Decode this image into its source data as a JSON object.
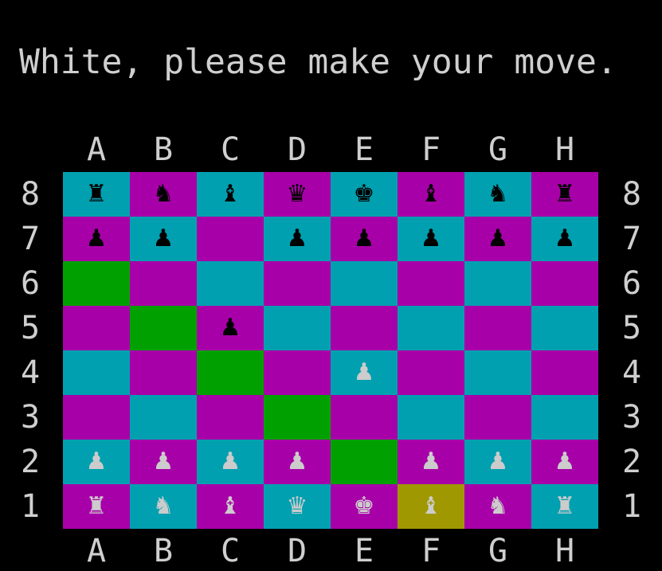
{
  "prompt": "White, please make your move.",
  "files": [
    "A",
    "B",
    "C",
    "D",
    "E",
    "F",
    "G",
    "H"
  ],
  "ranks": [
    "8",
    "7",
    "6",
    "5",
    "4",
    "3",
    "2",
    "1"
  ],
  "colors": {
    "background": "#000000",
    "text": "#cfcfcf",
    "square_cyan": "#00a0b0",
    "square_magenta": "#a800a8",
    "highlight_path": "#00a000",
    "highlight_selected": "#a09800",
    "piece_black": "#000000",
    "piece_white": "#cccccc"
  },
  "board": [
    [
      {
        "piece": "rook",
        "side": "black",
        "glyph": "♜"
      },
      {
        "piece": "knight",
        "side": "black",
        "glyph": "♞"
      },
      {
        "piece": "bishop",
        "side": "black",
        "glyph": "♝"
      },
      {
        "piece": "queen",
        "side": "black",
        "glyph": "♛"
      },
      {
        "piece": "king",
        "side": "black",
        "glyph": "♚"
      },
      {
        "piece": "bishop",
        "side": "black",
        "glyph": "♝"
      },
      {
        "piece": "knight",
        "side": "black",
        "glyph": "♞"
      },
      {
        "piece": "rook",
        "side": "black",
        "glyph": "♜"
      }
    ],
    [
      {
        "piece": "pawn",
        "side": "black",
        "glyph": "♟"
      },
      {
        "piece": "pawn",
        "side": "black",
        "glyph": "♟"
      },
      {
        "piece": "",
        "side": "",
        "glyph": ""
      },
      {
        "piece": "pawn",
        "side": "black",
        "glyph": "♟"
      },
      {
        "piece": "pawn",
        "side": "black",
        "glyph": "♟"
      },
      {
        "piece": "pawn",
        "side": "black",
        "glyph": "♟"
      },
      {
        "piece": "pawn",
        "side": "black",
        "glyph": "♟"
      },
      {
        "piece": "pawn",
        "side": "black",
        "glyph": "♟"
      }
    ],
    [
      {
        "piece": "",
        "side": "",
        "glyph": "",
        "highlight": "path"
      },
      {
        "piece": "",
        "side": "",
        "glyph": ""
      },
      {
        "piece": "",
        "side": "",
        "glyph": ""
      },
      {
        "piece": "",
        "side": "",
        "glyph": ""
      },
      {
        "piece": "",
        "side": "",
        "glyph": ""
      },
      {
        "piece": "",
        "side": "",
        "glyph": ""
      },
      {
        "piece": "",
        "side": "",
        "glyph": ""
      },
      {
        "piece": "",
        "side": "",
        "glyph": ""
      }
    ],
    [
      {
        "piece": "",
        "side": "",
        "glyph": ""
      },
      {
        "piece": "",
        "side": "",
        "glyph": "",
        "highlight": "path"
      },
      {
        "piece": "pawn",
        "side": "black",
        "glyph": "♟"
      },
      {
        "piece": "",
        "side": "",
        "glyph": ""
      },
      {
        "piece": "",
        "side": "",
        "glyph": ""
      },
      {
        "piece": "",
        "side": "",
        "glyph": ""
      },
      {
        "piece": "",
        "side": "",
        "glyph": ""
      },
      {
        "piece": "",
        "side": "",
        "glyph": ""
      }
    ],
    [
      {
        "piece": "",
        "side": "",
        "glyph": ""
      },
      {
        "piece": "",
        "side": "",
        "glyph": ""
      },
      {
        "piece": "",
        "side": "",
        "glyph": "",
        "highlight": "path"
      },
      {
        "piece": "",
        "side": "",
        "glyph": ""
      },
      {
        "piece": "pawn",
        "side": "white",
        "glyph": "♟"
      },
      {
        "piece": "",
        "side": "",
        "glyph": ""
      },
      {
        "piece": "",
        "side": "",
        "glyph": ""
      },
      {
        "piece": "",
        "side": "",
        "glyph": ""
      }
    ],
    [
      {
        "piece": "",
        "side": "",
        "glyph": ""
      },
      {
        "piece": "",
        "side": "",
        "glyph": ""
      },
      {
        "piece": "",
        "side": "",
        "glyph": ""
      },
      {
        "piece": "",
        "side": "",
        "glyph": "",
        "highlight": "path"
      },
      {
        "piece": "",
        "side": "",
        "glyph": ""
      },
      {
        "piece": "",
        "side": "",
        "glyph": ""
      },
      {
        "piece": "",
        "side": "",
        "glyph": ""
      },
      {
        "piece": "",
        "side": "",
        "glyph": ""
      }
    ],
    [
      {
        "piece": "pawn",
        "side": "white",
        "glyph": "♟"
      },
      {
        "piece": "pawn",
        "side": "white",
        "glyph": "♟"
      },
      {
        "piece": "pawn",
        "side": "white",
        "glyph": "♟"
      },
      {
        "piece": "pawn",
        "side": "white",
        "glyph": "♟"
      },
      {
        "piece": "",
        "side": "",
        "glyph": "",
        "highlight": "path"
      },
      {
        "piece": "pawn",
        "side": "white",
        "glyph": "♟"
      },
      {
        "piece": "pawn",
        "side": "white",
        "glyph": "♟"
      },
      {
        "piece": "pawn",
        "side": "white",
        "glyph": "♟"
      }
    ],
    [
      {
        "piece": "rook",
        "side": "white",
        "glyph": "♜"
      },
      {
        "piece": "knight",
        "side": "white",
        "glyph": "♞"
      },
      {
        "piece": "bishop",
        "side": "white",
        "glyph": "♝"
      },
      {
        "piece": "queen",
        "side": "white",
        "glyph": "♛"
      },
      {
        "piece": "king",
        "side": "white",
        "glyph": "♚"
      },
      {
        "piece": "bishop",
        "side": "white",
        "glyph": "♝",
        "highlight": "selected"
      },
      {
        "piece": "knight",
        "side": "white",
        "glyph": "♞"
      },
      {
        "piece": "rook",
        "side": "white",
        "glyph": "♜"
      }
    ]
  ]
}
